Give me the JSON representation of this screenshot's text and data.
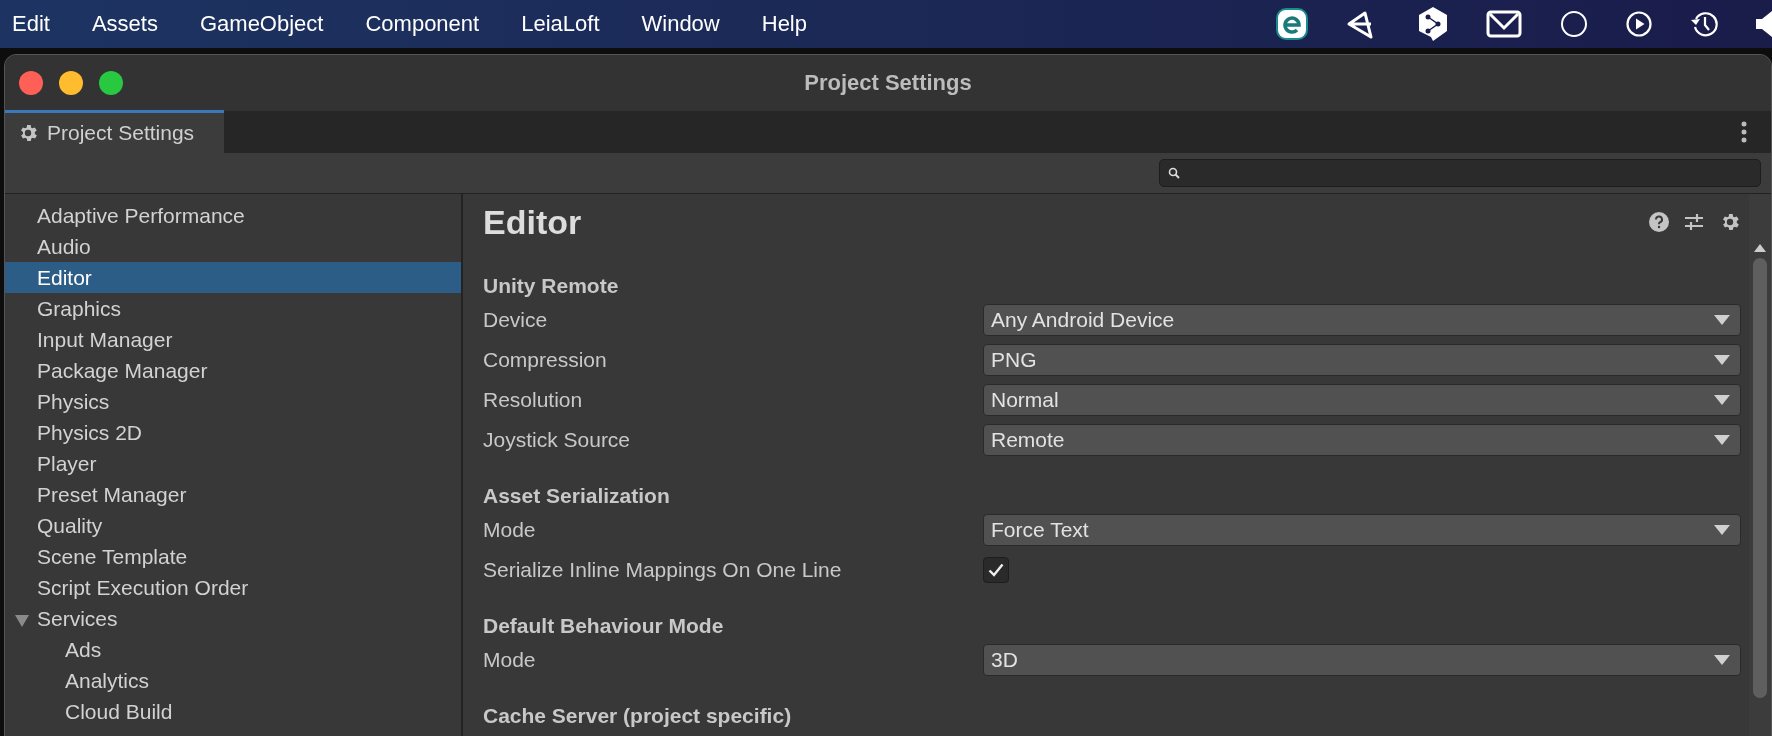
{
  "menubar": {
    "items": [
      "Edit",
      "Assets",
      "GameObject",
      "Component",
      "LeiaLoft",
      "Window",
      "Help"
    ]
  },
  "window": {
    "title": "Project Settings"
  },
  "tabs": [
    {
      "label": "Project Settings",
      "selected": true
    }
  ],
  "sidebar": {
    "items": [
      {
        "label": "Adaptive Performance",
        "selected": false
      },
      {
        "label": "Audio",
        "selected": false
      },
      {
        "label": "Editor",
        "selected": true
      },
      {
        "label": "Graphics",
        "selected": false
      },
      {
        "label": "Input Manager",
        "selected": false
      },
      {
        "label": "Package Manager",
        "selected": false
      },
      {
        "label": "Physics",
        "selected": false
      },
      {
        "label": "Physics 2D",
        "selected": false
      },
      {
        "label": "Player",
        "selected": false
      },
      {
        "label": "Preset Manager",
        "selected": false
      },
      {
        "label": "Quality",
        "selected": false
      },
      {
        "label": "Scene Template",
        "selected": false
      },
      {
        "label": "Script Execution Order",
        "selected": false
      },
      {
        "label": "Services",
        "selected": false,
        "expanded": true,
        "children": [
          {
            "label": "Ads",
            "selected": false
          },
          {
            "label": "Analytics",
            "selected": false
          },
          {
            "label": "Cloud Build",
            "selected": false
          }
        ]
      }
    ]
  },
  "panel": {
    "title": "Editor",
    "sections": [
      {
        "heading": "Unity Remote",
        "rows": [
          {
            "kind": "dropdown",
            "label": "Device",
            "value": "Any Android Device"
          },
          {
            "kind": "dropdown",
            "label": "Compression",
            "value": "PNG"
          },
          {
            "kind": "dropdown",
            "label": "Resolution",
            "value": "Normal"
          },
          {
            "kind": "dropdown",
            "label": "Joystick Source",
            "value": "Remote"
          }
        ]
      },
      {
        "heading": "Asset Serialization",
        "rows": [
          {
            "kind": "dropdown",
            "label": "Mode",
            "value": "Force Text"
          },
          {
            "kind": "checkbox",
            "label": "Serialize Inline Mappings On One Line",
            "checked": true
          }
        ]
      },
      {
        "heading": "Default Behaviour Mode",
        "rows": [
          {
            "kind": "dropdown",
            "label": "Mode",
            "value": "3D"
          }
        ]
      },
      {
        "heading": "Cache Server (project specific)"
      }
    ]
  }
}
